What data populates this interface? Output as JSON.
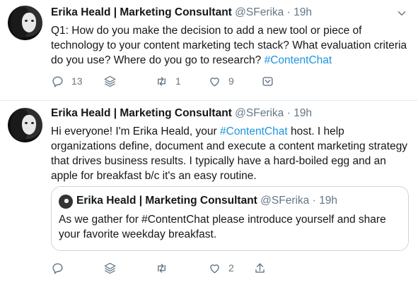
{
  "tweets": [
    {
      "author_name": "Erika Heald | Marketing Consultant",
      "handle": "@SFerika",
      "separator": "·",
      "time": "19h",
      "text_before": "Q1: How do you make the decision to add a new tool or piece of technology to your content marketing tech stack? What evaluation criteria do you use? Where do you go to research? ",
      "hashtag": "#ContentChat",
      "text_after": "",
      "reply_count": "13",
      "retweet_count": "1",
      "like_count": "9"
    },
    {
      "author_name": "Erika Heald | Marketing Consultant",
      "handle": "@SFerika",
      "separator": "·",
      "time": "19h",
      "text_before": "Hi everyone! I'm Erika Heald, your ",
      "hashtag": "#ContentChat",
      "text_after": " host. I help organizations define, document and execute a content marketing strategy that drives business results. I typically have a hard-boiled egg and an apple for breakfast b/c it's an easy routine.",
      "reply_count": "",
      "retweet_count": "",
      "like_count": "2",
      "quote": {
        "author_name": "Erika Heald | Marketing Consultant",
        "handle": "@SFerika",
        "separator": "·",
        "time": "19h",
        "text": "As we gather for #ContentChat please introduce yourself and share your favorite weekday breakfast."
      }
    }
  ],
  "icons": [
    "reply-icon",
    "layers-icon",
    "retweet-icon",
    "like-icon",
    "share-icon",
    "chevron-down-icon"
  ],
  "colors": {
    "link": "#1b95e0",
    "muted": "#657786",
    "text": "#14171a",
    "border": "#e6ecf0"
  }
}
